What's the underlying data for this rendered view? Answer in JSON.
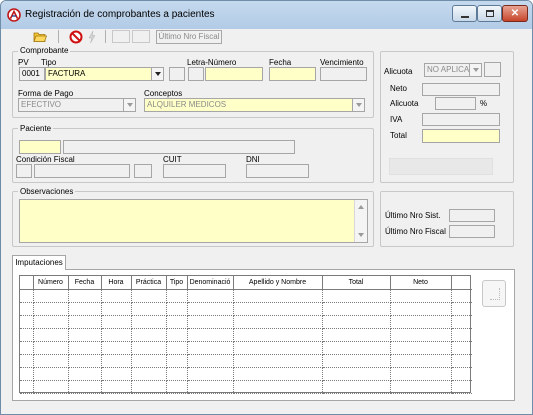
{
  "window": {
    "title": "Registración de comprobantes a pacientes",
    "close_glyph": "✕"
  },
  "toolbar": {
    "ultimo_nro_fiscal_button": "Último Nro Fiscal"
  },
  "comprobante": {
    "legend": "Comprobante",
    "pv_label": "PV",
    "pv_value": "0001",
    "tipo_label": "Tipo",
    "tipo_value": "FACTURA",
    "letra_numero_label": "Letra-Número",
    "letra_value": "",
    "numero_value": "",
    "fecha_label": "Fecha",
    "fecha_value": "",
    "vencimiento_label": "Vencimiento",
    "vencimiento_value": "",
    "forma_pago_label": "Forma de Pago",
    "forma_pago_value": "EFECTIVO",
    "conceptos_label": "Conceptos",
    "conceptos_value": "ALQUILER MEDICOS"
  },
  "paciente": {
    "legend": "Paciente",
    "codigo_value": "",
    "nombre_value": "",
    "condicion_fiscal_label": "Condición Fiscal",
    "cuit_label": "CUIT",
    "dni_label": "DNI"
  },
  "observaciones": {
    "legend": "Observaciones",
    "value": ""
  },
  "totales": {
    "alicuota_label": "Alicuota",
    "alicuota_select": "NO APLICA",
    "neto_label": "Neto",
    "alicuota2_label": "Alicuota",
    "percent_sign": "%",
    "iva_label": "IVA",
    "total_label": "Total"
  },
  "sistema": {
    "ultimo_nro_sist_label": "Último Nro Sist.",
    "ultimo_nro_fiscal_label": "Último Nro Fiscal"
  },
  "imputaciones": {
    "tab_label": "Imputaciones",
    "columns": [
      "Número",
      "Fecha",
      "Hora",
      "Práctica",
      "Tipo",
      "Denominació",
      "Apellido y Nombre",
      "Total",
      "Neto"
    ]
  }
}
